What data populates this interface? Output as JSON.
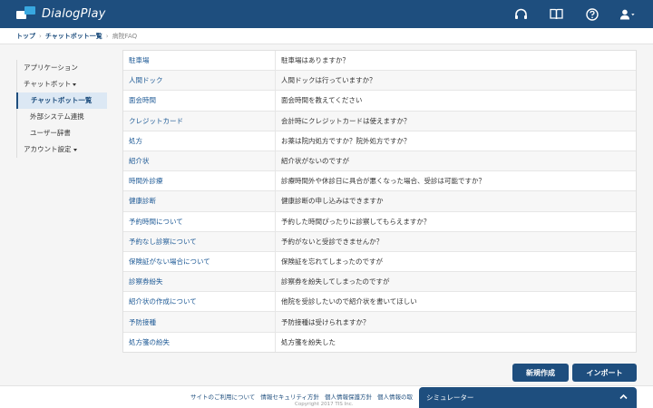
{
  "app": {
    "name": "DialogPlay"
  },
  "header": {
    "icons": [
      "headset-icon",
      "book-icon",
      "help-icon",
      "user-icon"
    ],
    "colors": {
      "background": "#1e4e7e",
      "accent": "#38a8e0"
    }
  },
  "breadcrumb": {
    "items": [
      "トップ",
      "チャットボット一覧",
      "病院FAQ"
    ]
  },
  "sidebar": {
    "applications": "アプリケーション",
    "chatbot": "チャットボット",
    "chatbot_list": "チャットボット一覧",
    "external_link": "外部システム連携",
    "user_dict": "ユーザー辞書",
    "account": "アカウント設定"
  },
  "faq": {
    "rows": [
      {
        "key": "駐車場",
        "value": "駐車場はありますか？"
      },
      {
        "key": "人間ドック",
        "value": "人間ドックは行っていますか？"
      },
      {
        "key": "面会時間",
        "value": "面会時間を教えてください"
      },
      {
        "key": "クレジットカード",
        "value": "会計時にクレジットカードは使えますか？"
      },
      {
        "key": "処方",
        "value": "お薬は院内処方ですか？院外処方ですか？"
      },
      {
        "key": "紹介状",
        "value": "紹介状がないのですが"
      },
      {
        "key": "時間外診療",
        "value": "診療時間外や休診日に具合が悪くなった場合、受診は可能ですか？"
      },
      {
        "key": "健康診断",
        "value": "健康診断の申し込みはできますか"
      },
      {
        "key": "予約時間について",
        "value": "予約した時間ぴったりに診察してもらえますか？"
      },
      {
        "key": "予約なし診察について",
        "value": "予約がないと受診できませんか？"
      },
      {
        "key": "保険証がない場合について",
        "value": "保険証を忘れてしまったのですが"
      },
      {
        "key": "診察券紛失",
        "value": "診察券を紛失してしまったのですが"
      },
      {
        "key": "紹介状の作成について",
        "value": "他院を受診したいので紹介状を書いてほしい"
      },
      {
        "key": "予防接種",
        "value": "予防接種は受けられますか？"
      },
      {
        "key": "処方箋の紛失",
        "value": "処方箋を紛失した"
      }
    ]
  },
  "actions": {
    "new_label": "新規作成",
    "import_label": "インポート"
  },
  "footer": {
    "links": [
      "サイトのご利用について",
      "情報セキュリティ方針",
      "個人情報保護方針",
      "個人情報の取"
    ],
    "copyright": "Copyright 2017 TIS Inc."
  },
  "simulator": {
    "label": "シミュレーター"
  }
}
